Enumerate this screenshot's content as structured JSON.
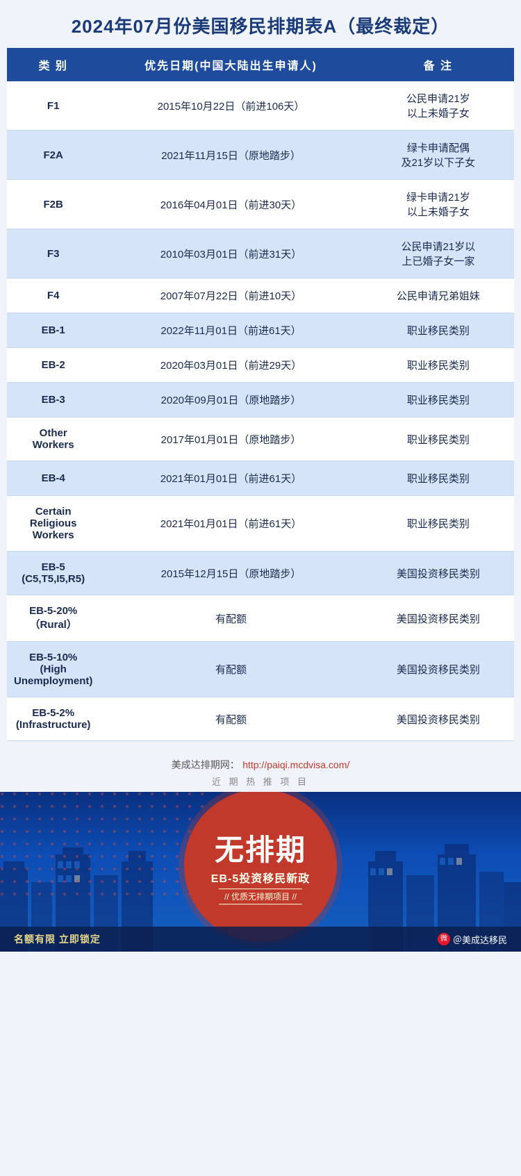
{
  "title": "2024年07月份美国移民排期表A（最终裁定）",
  "table": {
    "headers": [
      "类 别",
      "优先日期(中国大陆出生申请人)",
      "备  注"
    ],
    "rows": [
      {
        "category": "F1",
        "priority_date": "2015年10月22日（前进106天）",
        "note": "公民申请21岁\n以上未婚子女"
      },
      {
        "category": "F2A",
        "priority_date": "2021年11月15日（原地踏步）",
        "note": "绿卡申请配偶\n及21岁以下子女"
      },
      {
        "category": "F2B",
        "priority_date": "2016年04月01日（前进30天）",
        "note": "绿卡申请21岁\n以上未婚子女"
      },
      {
        "category": "F3",
        "priority_date": "2010年03月01日（前进31天）",
        "note": "公民申请21岁以\n上已婚子女一家"
      },
      {
        "category": "F4",
        "priority_date": "2007年07月22日（前进10天）",
        "note": "公民申请兄弟姐妹"
      },
      {
        "category": "EB-1",
        "priority_date": "2022年11月01日（前进61天）",
        "note": "职业移民类别"
      },
      {
        "category": "EB-2",
        "priority_date": "2020年03月01日（前进29天）",
        "note": "职业移民类别"
      },
      {
        "category": "EB-3",
        "priority_date": "2020年09月01日（原地踏步）",
        "note": "职业移民类别"
      },
      {
        "category": "Other\nWorkers",
        "priority_date": "2017年01月01日（原地踏步）",
        "note": "职业移民类别"
      },
      {
        "category": "EB-4",
        "priority_date": "2021年01月01日（前进61天）",
        "note": "职业移民类别"
      },
      {
        "category": "Certain\nReligious\nWorkers",
        "priority_date": "2021年01月01日（前进61天）",
        "note": "职业移民类别"
      },
      {
        "category": "EB-5\n(C5,T5,I5,R5)",
        "priority_date": "2015年12月15日（原地踏步）",
        "note": "美国投资移民类别"
      },
      {
        "category": "EB-5-20%\n（Rural）",
        "priority_date": "有配额",
        "note": "美国投资移民类别"
      },
      {
        "category": "EB-5-10%\n(High Unemployment)",
        "priority_date": "有配额",
        "note": "美国投资移民类别"
      },
      {
        "category": "EB-5-2%\n(Infrastructure)",
        "priority_date": "有配额",
        "note": "美国投资移民类别"
      }
    ]
  },
  "footer": {
    "site_label": "美成达排期网：",
    "site_url": "http://paiqi.mcdvisa.com/",
    "hot_label": "近 期 热 推 项 目"
  },
  "banner": {
    "main_text": "无排期",
    "sub_text": "EB-5投资移民新政",
    "divider_text": "// 优质无排期项目 //",
    "bottom_left": "名额有限 立即锁定",
    "bottom_right": "＠美成达移民"
  }
}
